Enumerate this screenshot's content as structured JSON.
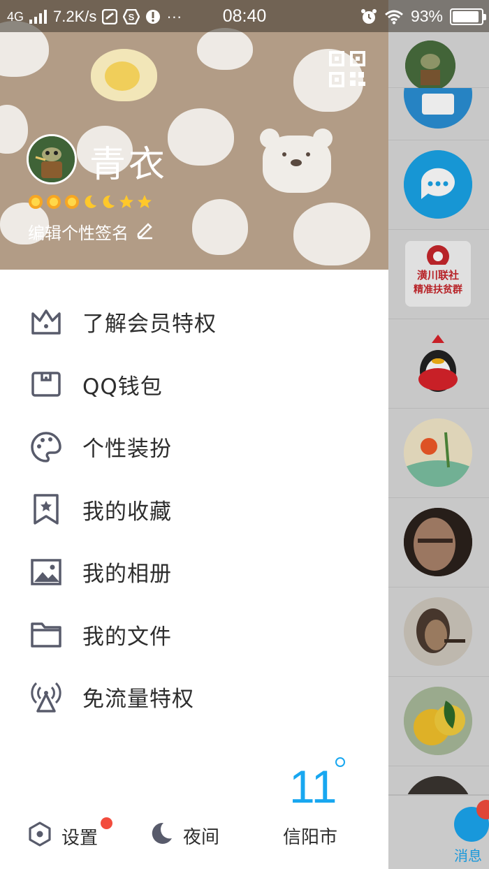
{
  "status_bar": {
    "network": "4G",
    "speed": "7.2K/s",
    "dots": "···",
    "time": "08:40",
    "battery": "93%",
    "battery_level": 0.93
  },
  "drawer": {
    "nickname": "青衣",
    "signature": "编辑个性签名",
    "level_icons": [
      "sun-icon",
      "sun-icon",
      "sun-icon",
      "moon-icon",
      "moon-icon",
      "star-icon",
      "star-icon"
    ],
    "menu": [
      {
        "label": "了解会员特权",
        "icon": "crown-icon"
      },
      {
        "label": "QQ钱包",
        "icon": "wallet-icon"
      },
      {
        "label": "个性装扮",
        "icon": "palette-icon"
      },
      {
        "label": "我的收藏",
        "icon": "bookmark-star-icon"
      },
      {
        "label": "我的相册",
        "icon": "photo-icon"
      },
      {
        "label": "我的文件",
        "icon": "folder-icon"
      },
      {
        "label": "免流量特权",
        "icon": "broadcast-icon"
      }
    ],
    "weather": {
      "temp": "11",
      "city": "信阳市"
    },
    "settings_label": "设置",
    "night_label": "夜间"
  },
  "background_list": {
    "banner_line1": "潢川联社",
    "banner_line2": "精准扶贫群",
    "tab_label": "消息"
  },
  "colors": {
    "accent": "#18a7f0",
    "header_bg": "#b29c86",
    "badge_red": "#f24c3d",
    "icon_gray": "#585b6b"
  }
}
